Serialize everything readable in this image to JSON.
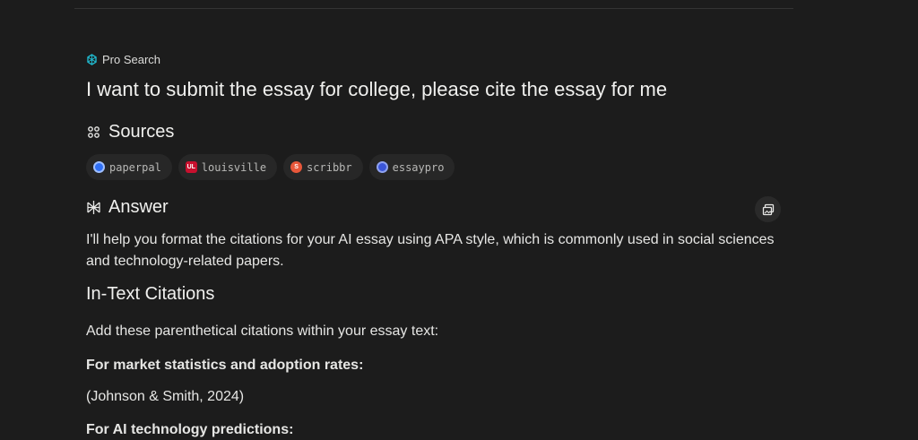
{
  "mode_label": "Pro Search",
  "query": "I want to submit the essay for college, please cite the essay for me",
  "sources": {
    "heading": "Sources",
    "items": [
      {
        "label": "paperpal",
        "color": "#2f6ff5",
        "glyph": ""
      },
      {
        "label": "louisville",
        "color": "#c8102e",
        "glyph": "UL"
      },
      {
        "label": "scribbr",
        "color": "#e8573a",
        "glyph": "S"
      },
      {
        "label": "essaypro",
        "color": "#3a55d8",
        "glyph": ""
      }
    ]
  },
  "answer": {
    "heading": "Answer",
    "intro": "I'll help you format the citations for your AI essay using APA style, which is commonly used in social sciences and technology-related papers.",
    "subheading": "In-Text Citations",
    "instruction": "Add these parenthetical citations within your essay text:",
    "item1_label": "For market statistics and adoption rates:",
    "item1_citation": "(Johnson & Smith, 2024)",
    "item2_label": "For AI technology predictions:"
  },
  "icons": {
    "mode": "pro-search-icon",
    "sources": "sources-icon",
    "answer": "answer-icon",
    "image_button": "image-search-icon"
  },
  "colors": {
    "background": "#1c1c1c",
    "accent": "#20b8cd",
    "chip_bg": "#272727"
  }
}
